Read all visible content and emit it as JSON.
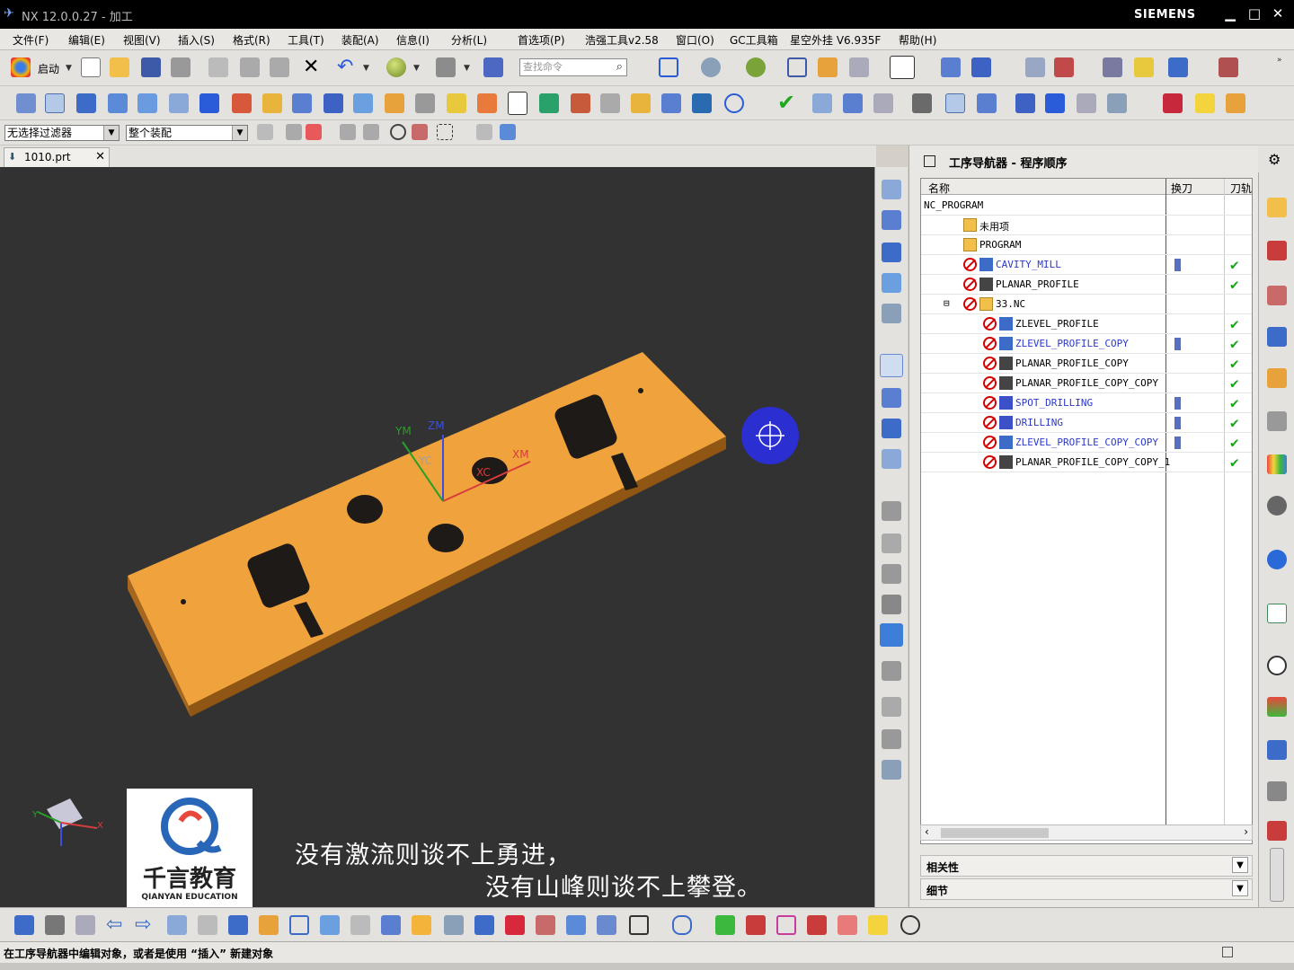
{
  "window": {
    "title": "NX 12.0.0.27 - 加工",
    "brand": "SIEMENS",
    "minimize": "▁",
    "maximize": "□",
    "close": "✕"
  },
  "menu": [
    "文件(F)",
    "编辑(E)",
    "视图(V)",
    "插入(S)",
    "格式(R)",
    "工具(T)",
    "装配(A)",
    "信息(I)",
    "分析(L)",
    "首选项(P)",
    "浩强工具v2.58",
    "窗口(O)",
    "GC工具箱",
    "星空外挂 V6.935F",
    "帮助(H)"
  ],
  "toolbar": {
    "start_label": "启动",
    "search_placeholder": "查找命令"
  },
  "selection_bar": {
    "filter_value": "无选择过滤器",
    "assembly_value": "整个装配"
  },
  "file_tab": {
    "label": "1010.prt"
  },
  "viewport": {
    "background": "#323232",
    "part_color": "#f0a23c",
    "csys_labels": {
      "ym": "YM",
      "zm": "ZM",
      "yc": "YC",
      "xc": "XC",
      "xm": "XM"
    },
    "triad_labels": {
      "x": "X",
      "y": "Y"
    },
    "subtitle_line1": "没有激流则谈不上勇进，",
    "subtitle_line2": "没有山峰则谈不上攀登。",
    "logo_text": "千言教育",
    "logo_subtext": "QIANYAN EDUCATION"
  },
  "navigator": {
    "title": "工序导航器 - 程序顺序",
    "columns": [
      "名称",
      "换刀",
      "刀轨"
    ],
    "rows": [
      {
        "name": "NC_PROGRAM",
        "indent": 0,
        "kind": "root",
        "blocked": false,
        "tool": false,
        "check": false,
        "blue": false
      },
      {
        "name": "未用项",
        "indent": 1,
        "kind": "folder",
        "blocked": false,
        "tool": false,
        "check": false,
        "blue": false
      },
      {
        "name": "PROGRAM",
        "indent": 1,
        "kind": "folder-bulb",
        "blocked": false,
        "tool": false,
        "check": false,
        "blue": false
      },
      {
        "name": "CAVITY_MILL",
        "indent": 1,
        "kind": "op-mill",
        "blocked": true,
        "tool": true,
        "check": true,
        "blue": true
      },
      {
        "name": "PLANAR_PROFILE",
        "indent": 1,
        "kind": "op-planar",
        "blocked": true,
        "tool": false,
        "check": true,
        "blue": false
      },
      {
        "name": "33.NC",
        "indent": 1,
        "kind": "folder-open",
        "blocked": true,
        "tool": false,
        "check": false,
        "blue": false
      },
      {
        "name": "ZLEVEL_PROFILE",
        "indent": 2,
        "kind": "op-mill",
        "blocked": true,
        "tool": false,
        "check": true,
        "blue": false
      },
      {
        "name": "ZLEVEL_PROFILE_COPY",
        "indent": 2,
        "kind": "op-mill",
        "blocked": true,
        "tool": true,
        "check": true,
        "blue": true
      },
      {
        "name": "PLANAR_PROFILE_COPY",
        "indent": 2,
        "kind": "op-planar",
        "blocked": true,
        "tool": false,
        "check": true,
        "blue": false
      },
      {
        "name": "PLANAR_PROFILE_COPY_COPY",
        "indent": 2,
        "kind": "op-planar",
        "blocked": true,
        "tool": false,
        "check": true,
        "blue": false
      },
      {
        "name": "SPOT_DRILLING",
        "indent": 2,
        "kind": "op-drill",
        "blocked": true,
        "tool": true,
        "check": true,
        "blue": true
      },
      {
        "name": "DRILLING",
        "indent": 2,
        "kind": "op-drill",
        "blocked": true,
        "tool": true,
        "check": true,
        "blue": true
      },
      {
        "name": "ZLEVEL_PROFILE_COPY_COPY",
        "indent": 2,
        "kind": "op-mill",
        "blocked": true,
        "tool": true,
        "check": true,
        "blue": true
      },
      {
        "name": "PLANAR_PROFILE_COPY_COPY_1",
        "indent": 2,
        "kind": "op-planar",
        "blocked": true,
        "tool": false,
        "check": true,
        "blue": false
      }
    ],
    "relations_label": "相关性",
    "details_label": "细节"
  },
  "status": {
    "text": "在工序导航器中编辑对象，或者是使用 “插入” 新建对象"
  },
  "colors": {
    "accent_blue": "#2b38c8",
    "check_green": "#19a51a",
    "blocked_red": "#d30000",
    "cursor_blue": "#2b2fd1"
  }
}
